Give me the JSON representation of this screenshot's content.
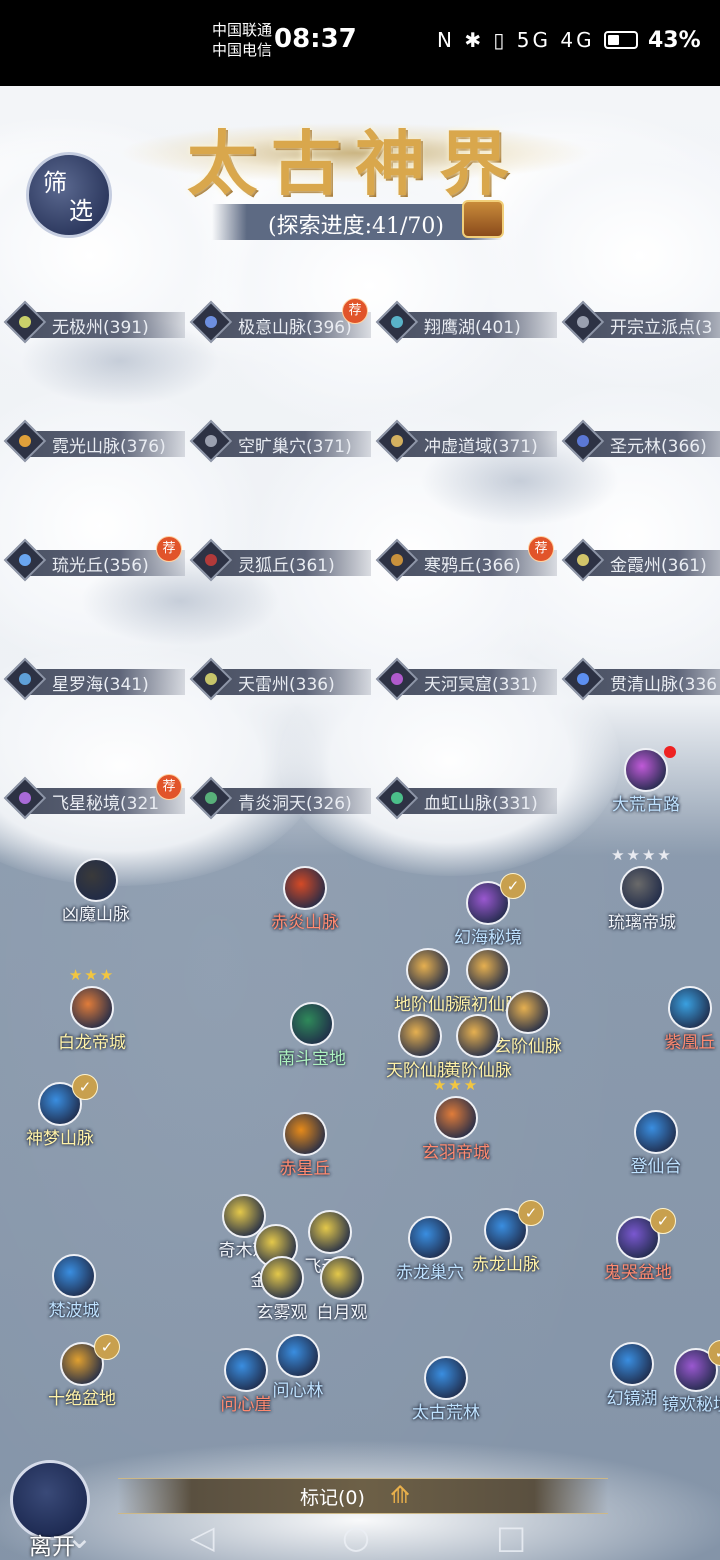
{
  "status_bar": {
    "carrier_1": "中国联通",
    "carrier_2": "中国电信",
    "time": "08:37",
    "signal_icons": "N ✱ ▯ 5G 4G",
    "battery_percent": 43,
    "battery_text": "43%"
  },
  "header": {
    "title": "太古神界",
    "filter_label_1": "筛",
    "filter_label_2": "选",
    "progress_text": "(探索进度:41/70)",
    "progress_current": 41,
    "progress_total": 70
  },
  "tags": [
    {
      "label": "无极州(391)",
      "color": "#c9d06a",
      "badge": ""
    },
    {
      "label": "极意山脉(396)",
      "color": "#6d8fe0",
      "badge": "荐"
    },
    {
      "label": "翔鹰湖(401)",
      "color": "#59b3c8",
      "badge": ""
    },
    {
      "label": "开宗立派点(3",
      "color": "#9aa0b0",
      "badge": ""
    },
    {
      "label": "霓光山脉(376)",
      "color": "#e0a03a",
      "badge": ""
    },
    {
      "label": "空旷巢穴(371)",
      "color": "#9aa0b0",
      "badge": ""
    },
    {
      "label": "冲虚道域(371)",
      "color": "#d3b060",
      "badge": ""
    },
    {
      "label": "圣元林(366)",
      "color": "#5b78d6",
      "badge": ""
    },
    {
      "label": "琉光丘(356)",
      "color": "#6aa6f0",
      "badge": "荐"
    },
    {
      "label": "灵狐丘(361)",
      "color": "#b23a3a",
      "badge": ""
    },
    {
      "label": "寒鸦丘(366)",
      "color": "#c8913c",
      "badge": "荐"
    },
    {
      "label": "金霞州(361)",
      "color": "#d2c56a",
      "badge": ""
    },
    {
      "label": "星罗海(341)",
      "color": "#5fa0d8",
      "badge": ""
    },
    {
      "label": "天雷州(336)",
      "color": "#c6c46a",
      "badge": ""
    },
    {
      "label": "天河冥窟(331)",
      "color": "#b05acd",
      "badge": ""
    },
    {
      "label": "贯清山脉(336",
      "color": "#5d8ff0",
      "badge": ""
    },
    {
      "label": "飞星秘境(321",
      "color": "#a86ad8",
      "badge": "荐"
    },
    {
      "label": "青炎洞天(326)",
      "color": "#58b07a",
      "badge": ""
    },
    {
      "label": "血虹山脉(331)",
      "color": "#4bbf8a",
      "badge": ""
    }
  ],
  "nodes": [
    {
      "label": "大荒古路",
      "stars": "",
      "style": "sw-blue"
    },
    {
      "label": "凶魔山脉",
      "stars": "",
      "style": "sw-white"
    },
    {
      "label": "赤炎山脉",
      "stars": "",
      "style": "sw-red"
    },
    {
      "label": "幻海秘境",
      "stars": "",
      "style": "sw-blue"
    },
    {
      "label": "琉璃帝城",
      "stars": "★★★★",
      "style": "sw-white"
    },
    {
      "label": "白龙帝城",
      "stars": "★★★",
      "style": "sw-gold"
    },
    {
      "label": "地阶仙脉",
      "stars": "",
      "style": "sw-gold"
    },
    {
      "label": "源初仙脉",
      "stars": "",
      "style": "sw-gold"
    },
    {
      "label": "南斗宝地",
      "stars": "",
      "style": "sw-green"
    },
    {
      "label": "玄阶仙脉",
      "stars": "",
      "style": "sw-gold"
    },
    {
      "label": "紫凰丘",
      "stars": "",
      "style": "sw-red"
    },
    {
      "label": "天阶仙脉",
      "stars": "",
      "style": "sw-gold"
    },
    {
      "label": "黄阶仙脉",
      "stars": "",
      "style": "sw-gold"
    },
    {
      "label": "神梦山脉",
      "stars": "",
      "style": "sw-gold"
    },
    {
      "label": "玄羽帝城",
      "stars": "★★★",
      "style": "sw-red"
    },
    {
      "label": "赤星丘",
      "stars": "",
      "style": "sw-red"
    },
    {
      "label": "登仙台",
      "stars": "",
      "style": "sw-blue"
    },
    {
      "label": "奇木观",
      "stars": "",
      "style": "sw-white"
    },
    {
      "label": "飞云观",
      "stars": "",
      "style": "sw-white"
    },
    {
      "label": "金涛观",
      "stars": "",
      "style": "sw-white"
    },
    {
      "label": "赤龙巢穴",
      "stars": "",
      "style": "sw-blue"
    },
    {
      "label": "赤龙山脉",
      "stars": "",
      "style": "sw-gold"
    },
    {
      "label": "鬼哭盆地",
      "stars": "",
      "style": "sw-red"
    },
    {
      "label": "梵波城",
      "stars": "",
      "style": "sw-blue"
    },
    {
      "label": "玄雾观",
      "stars": "",
      "style": "sw-white"
    },
    {
      "label": "白月观",
      "stars": "",
      "style": "sw-white"
    },
    {
      "label": "十绝盆地",
      "stars": "",
      "style": "sw-gold"
    },
    {
      "label": "问心崖",
      "stars": "",
      "style": "sw-red"
    },
    {
      "label": "问心林",
      "stars": "",
      "style": "sw-blue"
    },
    {
      "label": "太古荒林",
      "stars": "",
      "style": "sw-blue"
    },
    {
      "label": "幻镜湖",
      "stars": "",
      "style": "sw-blue"
    },
    {
      "label": "镜欢秘境",
      "stars": "",
      "style": "sw-blue"
    }
  ],
  "bottom": {
    "mark_label": "标记(0)",
    "leave_label": "离开"
  },
  "colors": {
    "title_gold": "#d9a74c",
    "recommend_badge": "#e1542a",
    "map_bg": "#8e9db0"
  }
}
